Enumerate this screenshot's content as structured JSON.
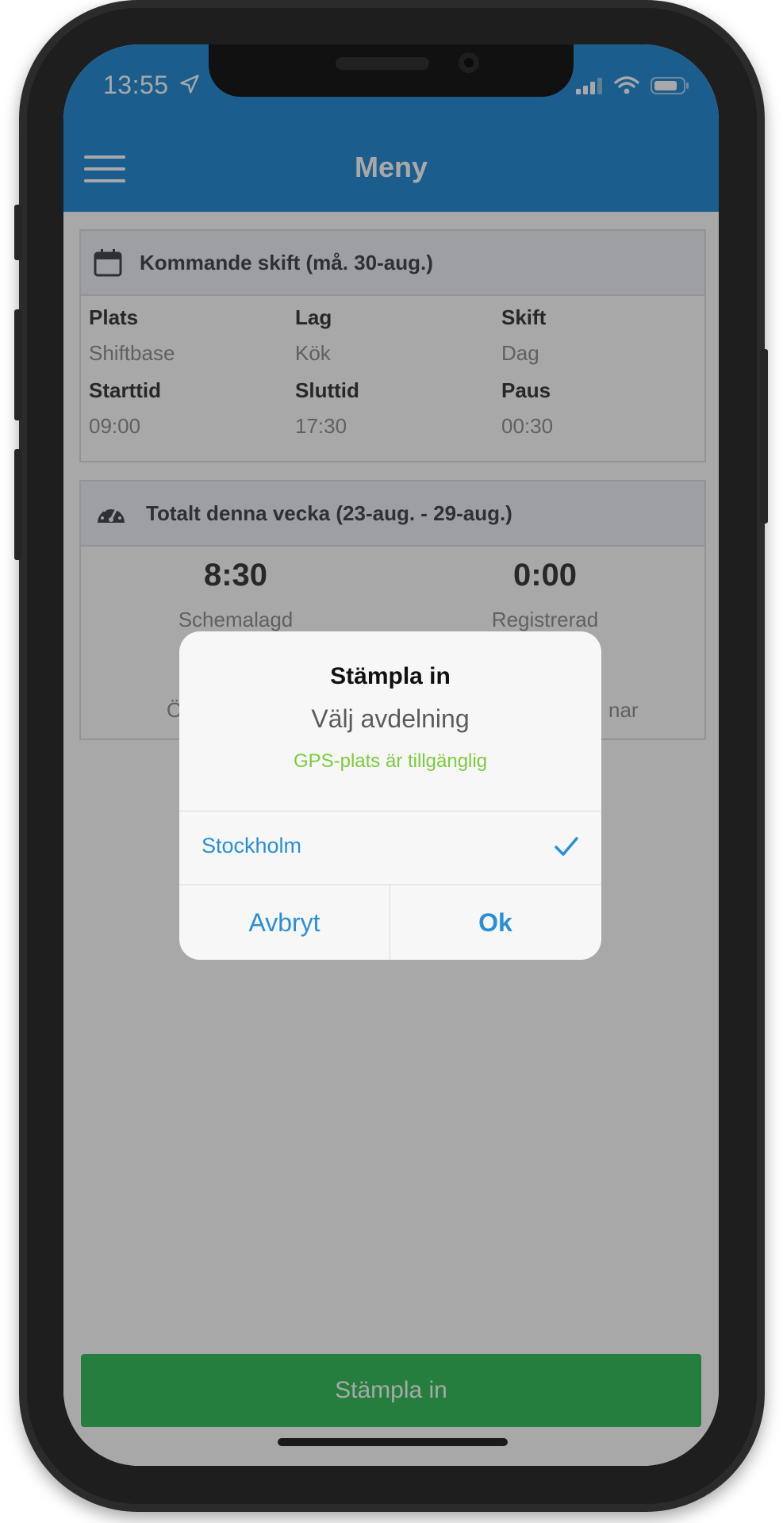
{
  "status": {
    "time": "13:55"
  },
  "header": {
    "title": "Meny"
  },
  "upcoming": {
    "heading": "Kommande skift (må. 30-aug.)",
    "fields": [
      {
        "label": "Plats",
        "value": "Shiftbase"
      },
      {
        "label": "Lag",
        "value": "Kök"
      },
      {
        "label": "Skift",
        "value": "Dag"
      },
      {
        "label": "Starttid",
        "value": "09:00"
      },
      {
        "label": "Sluttid",
        "value": "17:30"
      },
      {
        "label": "Paus",
        "value": "00:30"
      }
    ]
  },
  "week": {
    "heading": "Totalt denna vecka (23-aug. - 29-aug.)",
    "scheduled": {
      "value": "8:30",
      "label": "Schemalagd"
    },
    "registered": {
      "value": "0:00",
      "label": "Registrerad"
    },
    "partial_left": "Ö",
    "partial_right": "nar"
  },
  "dialog": {
    "title": "Stämpla in",
    "subtitle": "Välj avdelning",
    "gps": "GPS-plats är tillgänglig",
    "option": "Stockholm",
    "cancel": "Avbryt",
    "ok": "Ok"
  },
  "clock_in_button": "Stämpla in",
  "colors": {
    "accent": "#2a8fd7",
    "clock_in": "#39c05f",
    "gps": "#7ccb3f"
  }
}
